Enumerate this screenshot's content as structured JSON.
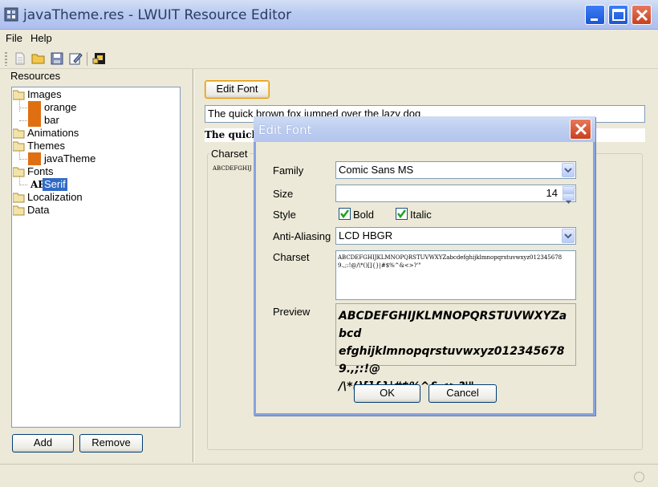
{
  "window": {
    "title": "javaTheme.res - LWUIT Resource Editor"
  },
  "menu": {
    "file": "File",
    "help": "Help"
  },
  "toolbar": {
    "buttons": [
      "new-icon",
      "open-folder-icon",
      "save-icon",
      "edit-icon",
      "export-icon"
    ]
  },
  "resources": {
    "label": "Resources",
    "tree": {
      "images": "Images",
      "image_orange": "orange",
      "image_bar": "bar",
      "animations": "Animations",
      "themes": "Themes",
      "theme_java": "javaTheme",
      "fonts": "Fonts",
      "font_prefix": "AB",
      "font_serif": "Serif",
      "localization": "Localization",
      "data": "Data"
    },
    "add_button": "Add",
    "remove_button": "Remove"
  },
  "main": {
    "edit_font_button": "Edit Font",
    "sample_text": "The quick brown fox jumped over the lazy dog",
    "sample_bold": "The quick b",
    "charset_label": "Charset",
    "charset_mini": "ABCDEFGHIJ"
  },
  "dialog": {
    "title": "Edit Font",
    "family_label": "Family",
    "family_value": "Comic Sans MS",
    "size_label": "Size",
    "size_value": "14",
    "style_label": "Style",
    "bold_label": "Bold",
    "bold_checked": true,
    "italic_label": "Italic",
    "italic_checked": true,
    "aa_label": "Anti-Aliasing",
    "aa_value": "LCD HBGR",
    "charset_label": "Charset",
    "charset_value": "ABCDEFGHIJKLMNOPQRSTUVWXYZabcdefghijklmnopqrstuvwxyz0123456789.,;:!@/\\*()[]{}|#$%^&<>?'\"",
    "preview_label": "Preview",
    "preview_line1": "ABCDEFGHIJKLMNOPQRSTUVWXYZabcd",
    "preview_line2": "efghijklmnopqrstuvwxyz0123456789.,;:!@",
    "preview_line3": "/\\*()[]{}|#$%^&<>?'\"",
    "ok_button": "OK",
    "cancel_button": "Cancel"
  },
  "colors": {
    "selection": "#316ac5",
    "image_swatch": "#e06f12",
    "focus_border": "#e59700"
  }
}
